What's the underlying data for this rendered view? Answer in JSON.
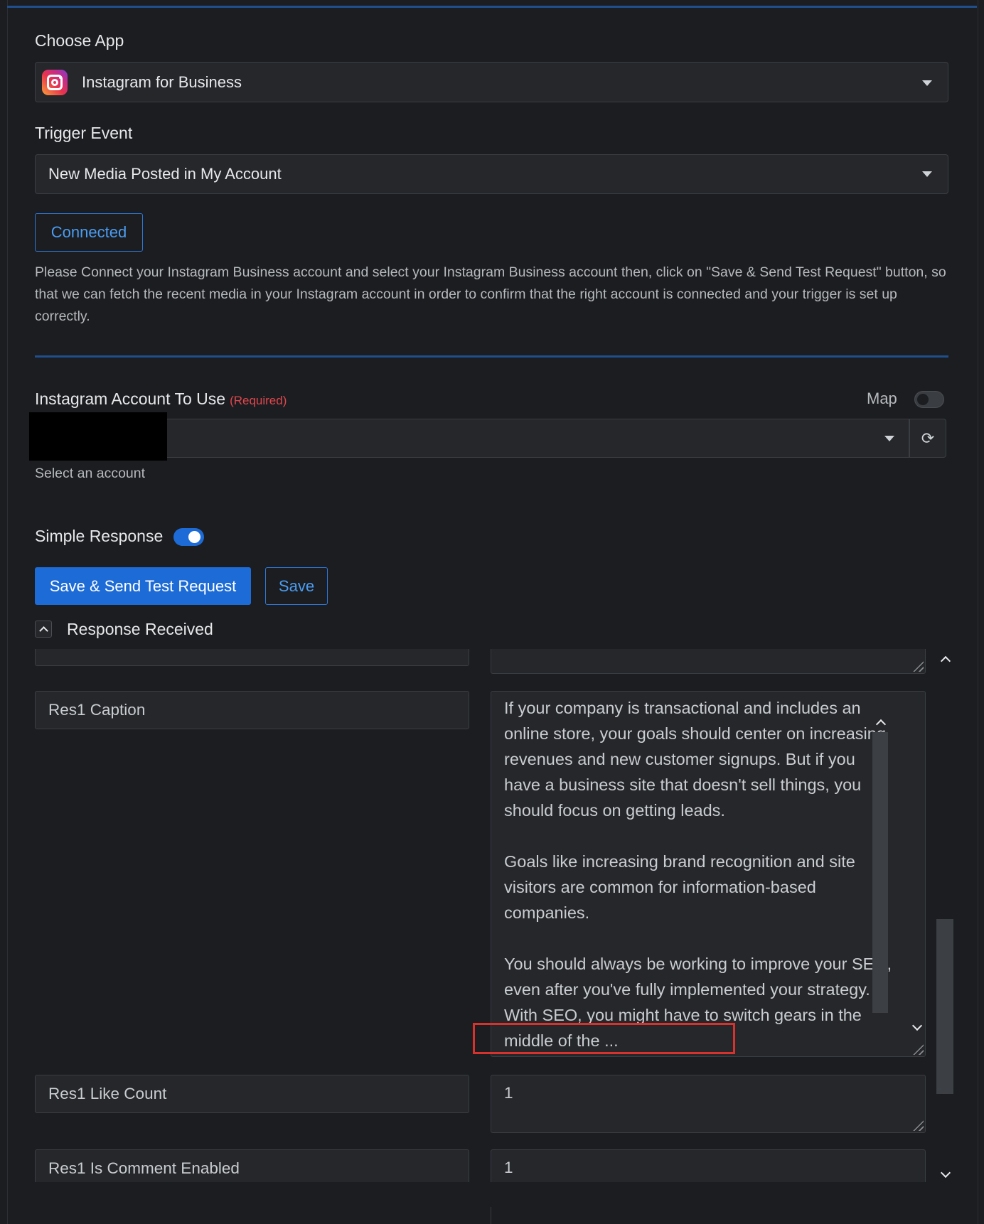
{
  "choose_app": {
    "label": "Choose App",
    "selected_app": "Instagram for Business",
    "app_icon": "instagram-icon"
  },
  "trigger_event": {
    "label": "Trigger Event",
    "selected": "New Media Posted in My Account"
  },
  "connection": {
    "status_button": "Connected",
    "help_text": "Please Connect your Instagram Business account and select your Instagram Business account then, click on \"Save & Send Test Request\" button, so that we can fetch the recent media in your Instagram account in order to confirm that the right account is connected and your trigger is set up correctly."
  },
  "account": {
    "label": "Instagram Account To Use",
    "required_label": "(Required)",
    "map_label": "Map",
    "map_toggle_on": false,
    "hint": "Select an account",
    "refresh_icon": "refresh-icon"
  },
  "simple_response": {
    "label": "Simple Response",
    "toggle_on": true
  },
  "actions": {
    "save_send_test": "Save & Send Test Request",
    "save": "Save"
  },
  "response": {
    "header": "Response Received",
    "fields": [
      {
        "key": "Res1 Caption",
        "value": "If your company is transactional and includes an online store, your goals should center on increasing revenues and new customer signups. But if you have a business site that doesn't sell things, you should focus on getting leads.\n\nGoals like increasing brand recognition and site visitors are common for information-based companies.\n\nYou should always be working to improve your SEO, even after you've fully implemented your strategy. With SEO, you might have to switch gears in the middle of the ..."
      },
      {
        "key": "Res1 Like Count",
        "value": "1"
      },
      {
        "key": "Res1 Is Comment Enabled",
        "value": "1"
      }
    ]
  },
  "colors": {
    "background": "#1b1d20",
    "accent": "#1d6bd6",
    "required": "#e0474d",
    "highlight": "#d8322f"
  }
}
